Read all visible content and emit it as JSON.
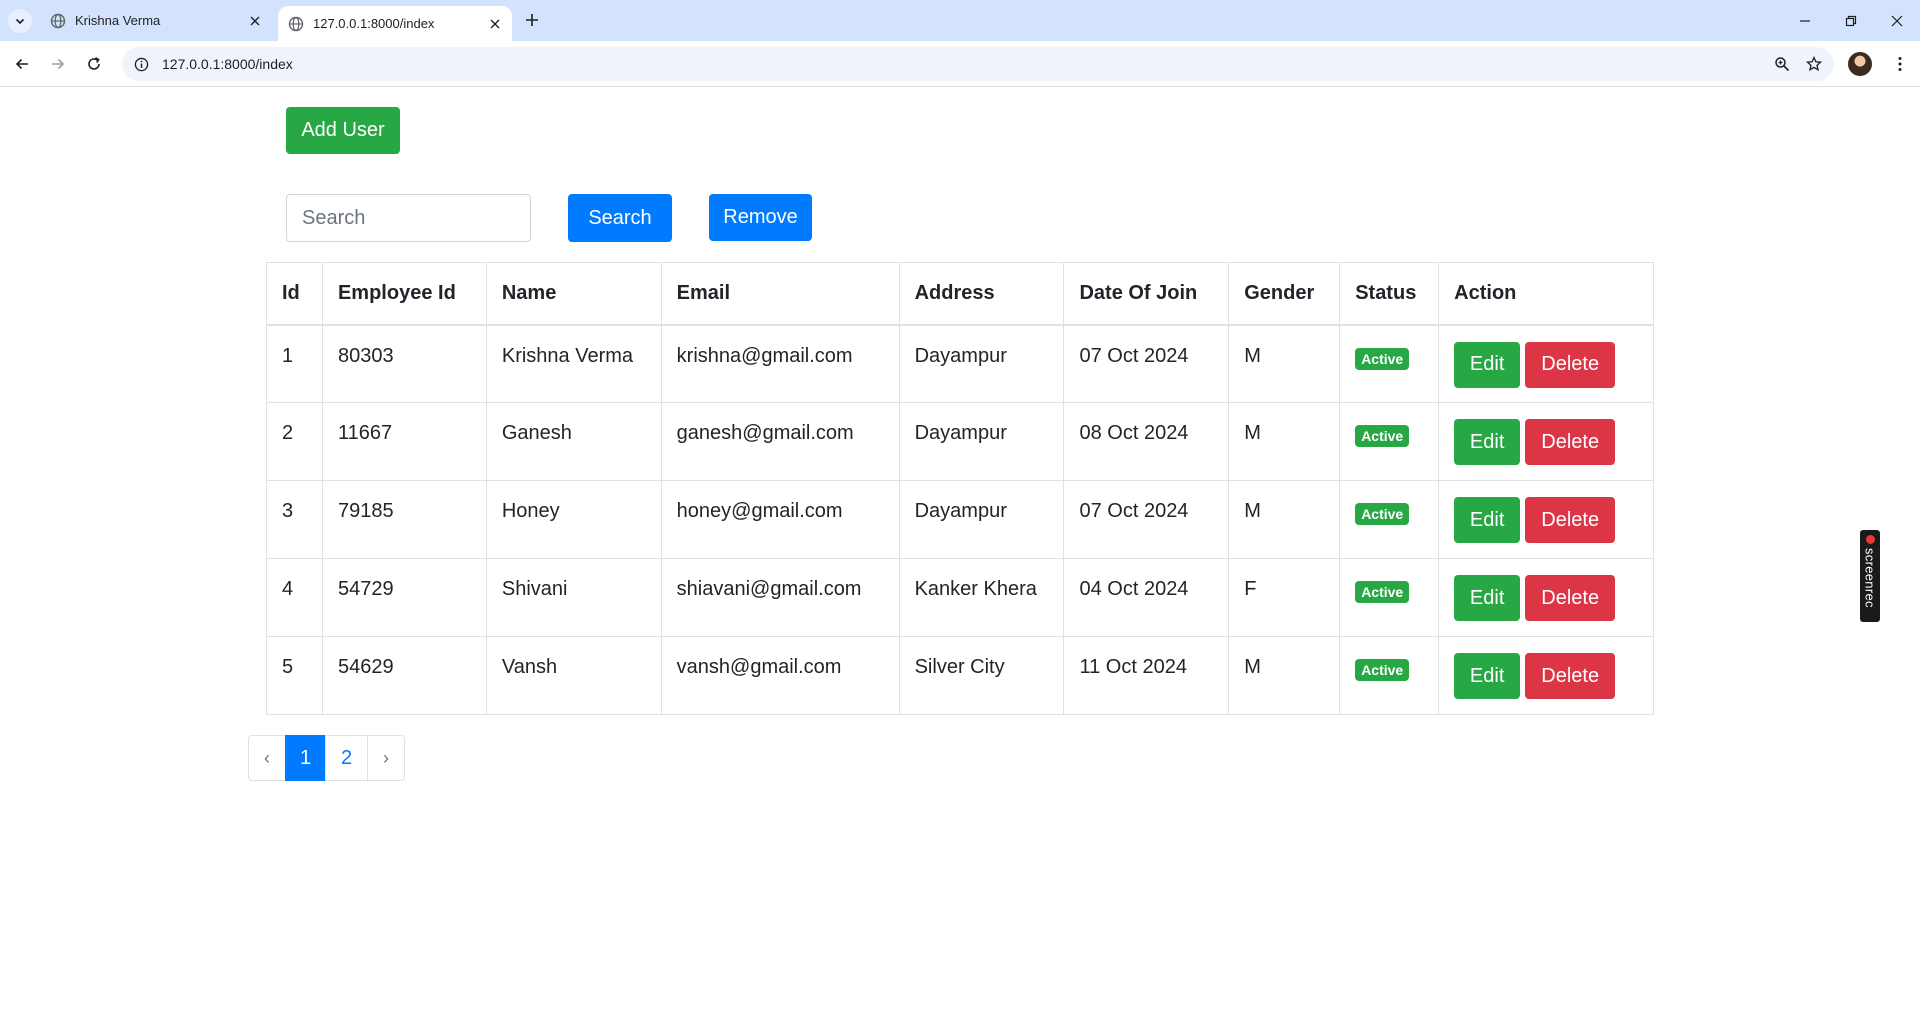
{
  "browser": {
    "tabs": [
      {
        "title": "Krishna Verma",
        "active": false
      },
      {
        "title": "127.0.0.1:8000/index",
        "active": true
      }
    ],
    "url": "127.0.0.1:8000/index",
    "icons": {
      "tab_menu": "chevron-down-icon",
      "favicon": "globe-icon",
      "close": "close-icon",
      "new_tab": "plus-icon",
      "back": "arrow-left-icon",
      "forward": "arrow-right-icon",
      "reload": "reload-icon",
      "site_info": "info-icon",
      "zoom": "zoom-icon",
      "bookmark": "star-icon",
      "menu": "kebab-icon"
    }
  },
  "page": {
    "add_user_label": "Add User",
    "search": {
      "placeholder": "Search",
      "value": ""
    },
    "search_button_label": "Search",
    "remove_button_label": "Remove",
    "table": {
      "columns": [
        "Id",
        "Employee Id",
        "Name",
        "Email",
        "Address",
        "Date Of Join",
        "Gender",
        "Status",
        "Action"
      ],
      "rows": [
        {
          "id": "1",
          "employee_id": "80303",
          "name": "Krishna Verma",
          "email": "krishna@gmail.com",
          "address": "Dayampur",
          "date_of_join": "07 Oct 2024",
          "gender": "M",
          "status": "Active"
        },
        {
          "id": "2",
          "employee_id": "11667",
          "name": "Ganesh",
          "email": "ganesh@gmail.com",
          "address": "Dayampur",
          "date_of_join": "08 Oct 2024",
          "gender": "M",
          "status": "Active"
        },
        {
          "id": "3",
          "employee_id": "79185",
          "name": "Honey",
          "email": "honey@gmail.com",
          "address": "Dayampur",
          "date_of_join": "07 Oct 2024",
          "gender": "M",
          "status": "Active"
        },
        {
          "id": "4",
          "employee_id": "54729",
          "name": "Shivani",
          "email": "shiavani@gmail.com",
          "address": "Kanker Khera",
          "date_of_join": "04 Oct 2024",
          "gender": "F",
          "status": "Active"
        },
        {
          "id": "5",
          "employee_id": "54629",
          "name": "Vansh",
          "email": "vansh@gmail.com",
          "address": "Silver City",
          "date_of_join": "11 Oct 2024",
          "gender": "M",
          "status": "Active"
        }
      ],
      "edit_label": "Edit",
      "delete_label": "Delete"
    },
    "pagination": {
      "prev": "‹",
      "pages": [
        "1",
        "2"
      ],
      "current": "1",
      "next": "›"
    }
  },
  "overlay": {
    "screenrec_label": "screenrec"
  },
  "colors": {
    "success": "#28a745",
    "primary": "#007bff",
    "danger": "#dc3545",
    "chrome_tabbar": "#d3e3fd"
  }
}
